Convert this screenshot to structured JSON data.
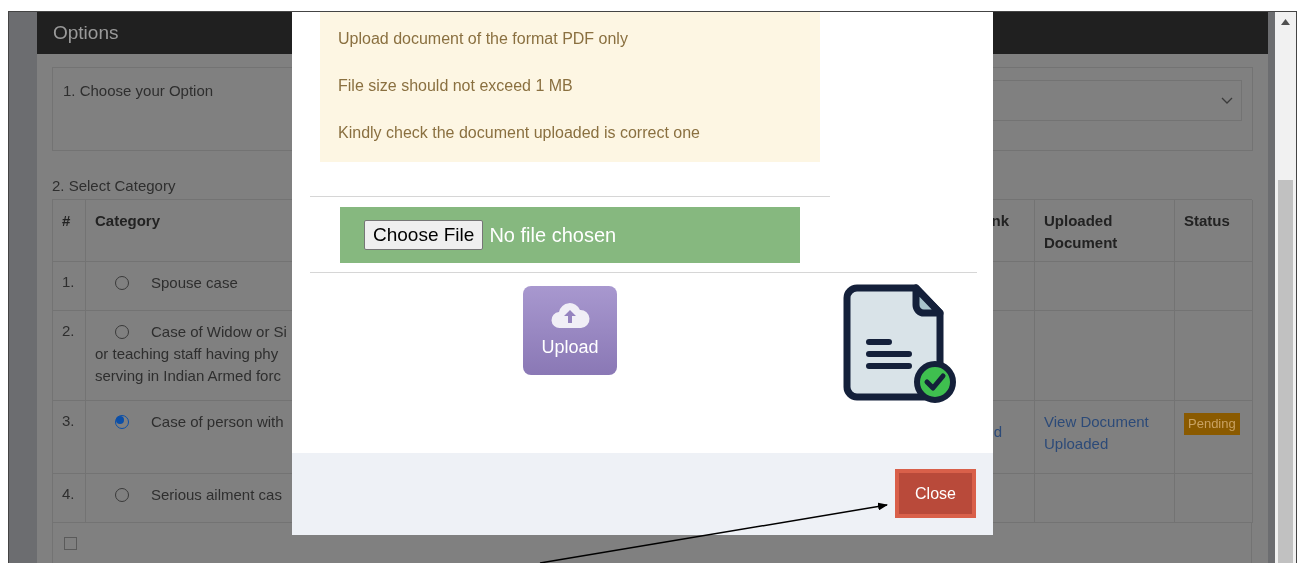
{
  "page": {
    "title": "Options",
    "option_label": "1. Choose your Option",
    "category_label": "2. Select Category",
    "table": {
      "columns": [
        "#",
        "Category",
        "nk",
        "Uploaded Document",
        "Status"
      ],
      "rows": [
        {
          "num": "1.",
          "lines": [
            "Spouse case"
          ],
          "selected": false
        },
        {
          "num": "2.",
          "lines": [
            "Case of Widow or Si",
            "or teaching staff having phy",
            "serving in Indian Armed forc"
          ],
          "selected": false
        },
        {
          "num": "3.",
          "lines": [
            "Case of person with"
          ],
          "selected": true,
          "link": "d",
          "document": "View Document Uploaded",
          "status": "Pending"
        },
        {
          "num": "4.",
          "lines": [
            "Serious ailment cas"
          ],
          "selected": false
        }
      ]
    },
    "exemption": {
      "checked": false
    }
  },
  "modal": {
    "notes": [
      "Upload document of the format PDF only",
      "File size should not exceed 1 MB",
      "Kindly check the document uploaded is correct one"
    ],
    "file_input": {
      "button": "Choose File",
      "value": "No file chosen"
    },
    "upload_button": "Upload",
    "close_button": "Close"
  }
}
